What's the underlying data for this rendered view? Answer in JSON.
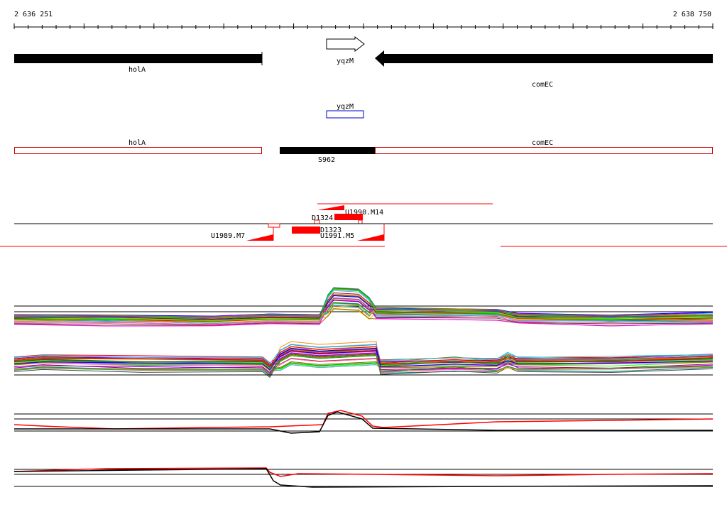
{
  "coordinates": {
    "start": "2 636 251",
    "end": "2 638 750"
  },
  "genes": {
    "holA": "holA",
    "yqzM": "yqzM",
    "comEC": "comEC"
  },
  "annotations": {
    "yqzM_box": "yqzM",
    "holA_box": "holA",
    "comEC_box": "comEC",
    "s962": "S962"
  },
  "features": {
    "u1990": "U1990.M14",
    "d1324": "D1324",
    "d1323": "D1323",
    "u1991": "U1991.M5",
    "u1989": "U1989.M7"
  },
  "colors": {
    "gene": "#000000",
    "annotation_box": "#cc0000",
    "feature_fill": "#ff0000",
    "yqzM_box": "#0000cc"
  }
}
